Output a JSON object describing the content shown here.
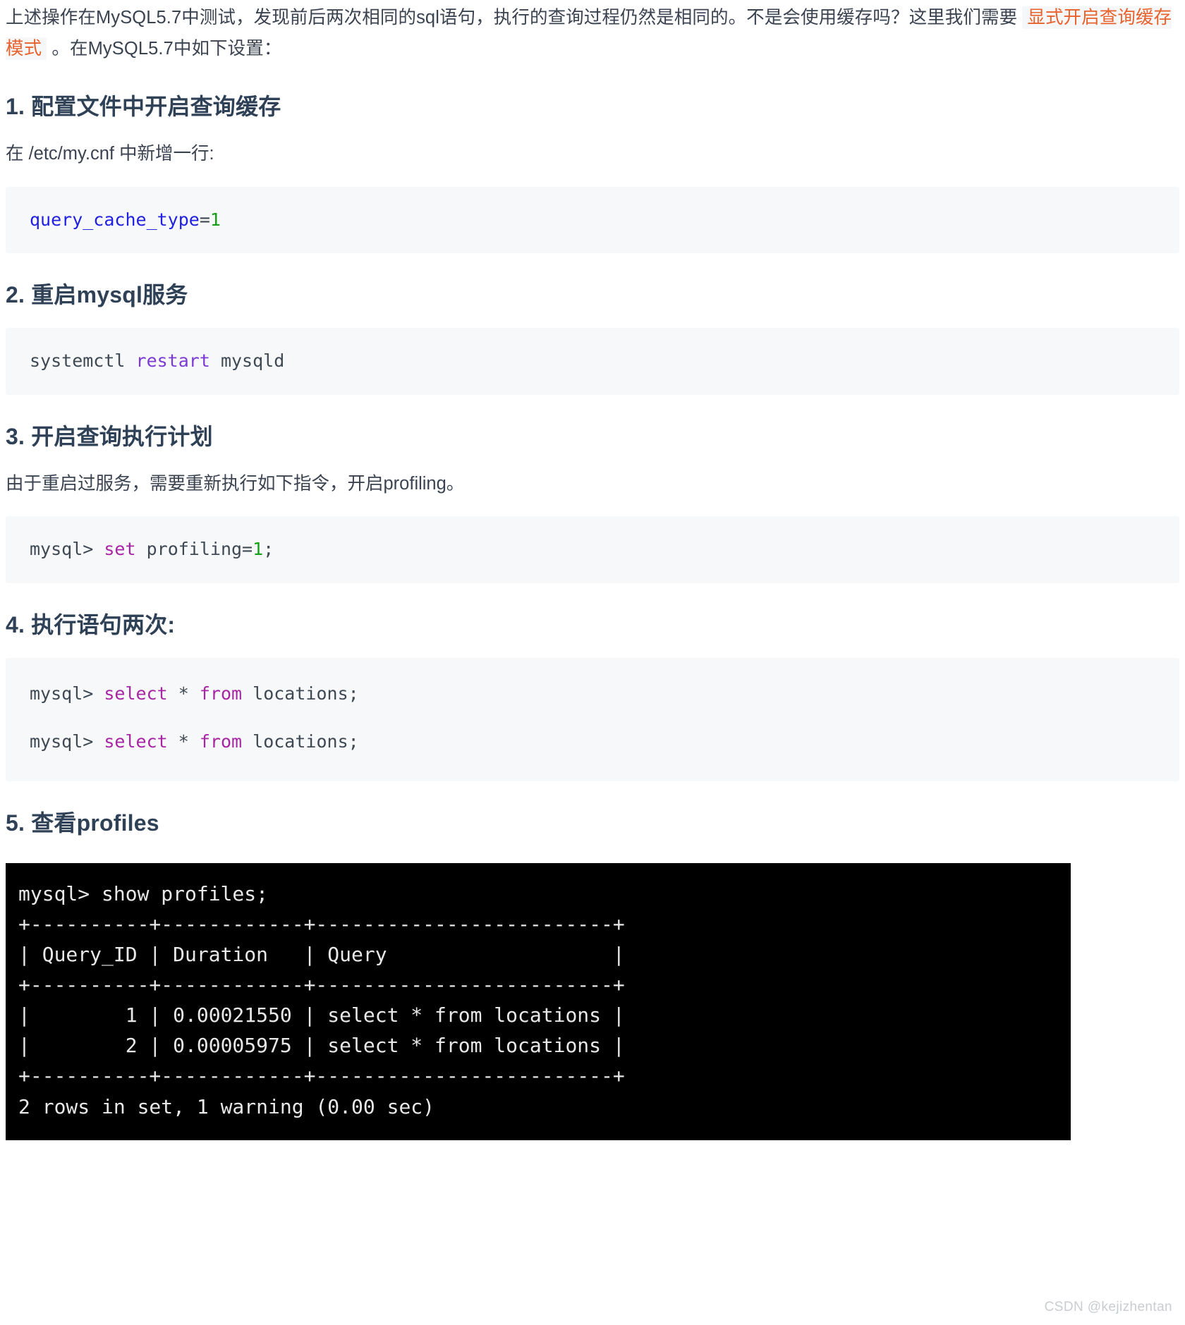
{
  "intro": {
    "part1": "上述操作在MySQL5.7中测试，发现前后两次相同的sql语句，执行的查询过程仍然是相同的。不是会使用缓存吗？这里我们需要 ",
    "highlight": "显式开启查询缓存模式",
    "part2": " 。在MySQL5.7中如下设置："
  },
  "sections": [
    {
      "number": "1.",
      "title": "配置文件中开启查询缓存",
      "subtext": "在 /etc/my.cnf 中新增一行:",
      "code": {
        "var": "query_cache_type",
        "op": "=",
        "num": "1",
        "full": "query_cache_type=1"
      }
    },
    {
      "number": "2.",
      "title": "重启mysql服务",
      "code": {
        "cmd": "systemctl",
        "kw": "restart",
        "arg": "mysqld",
        "full": "systemctl restart mysqld"
      }
    },
    {
      "number": "3.",
      "title": "开启查询执行计划",
      "subtext": "由于重启过服务，需要重新执行如下指令，开启profiling。",
      "code": {
        "prompt": "mysql>",
        "kw": "set",
        "expr": "profiling=",
        "num": "1",
        "semi": ";",
        "full": "mysql> set profiling=1;"
      }
    },
    {
      "number": "4.",
      "title": "执行语句两次:",
      "code": {
        "prompt": "mysql>",
        "kw_select": "select",
        "star": "*",
        "kw_from": "from",
        "table": "locations;",
        "full": "mysql> select * from locations;",
        "repeat": 2
      }
    },
    {
      "number": "5.",
      "title": "查看profiles"
    }
  ],
  "terminal": {
    "command": "mysql> show profiles;",
    "rule": "+----------+------------+-------------------------+",
    "header": "| Query_ID | Duration   | Query                   |",
    "rows": [
      "|        1 | 0.00021550 | select * from locations |",
      "|        2 | 0.00005975 | select * from locations |"
    ],
    "footer": "2 rows in set, 1 warning (0.00 sec)",
    "table": {
      "columns": [
        "Query_ID",
        "Duration",
        "Query"
      ],
      "data": [
        [
          "1",
          "0.00021550",
          "select * from locations"
        ],
        [
          "2",
          "0.00005975",
          "select * from locations"
        ]
      ]
    },
    "full_text": "mysql> show profiles;\n+----------+------------+-------------------------+\n| Query_ID | Duration   | Query                   |\n+----------+------------+-------------------------+\n|        1 | 0.00021550 | select * from locations |\n|        2 | 0.00005975 | select * from locations |\n+----------+------------+-------------------------+\n2 rows in set, 1 warning (0.00 sec)"
  },
  "watermark": "CSDN @kejizhentan"
}
